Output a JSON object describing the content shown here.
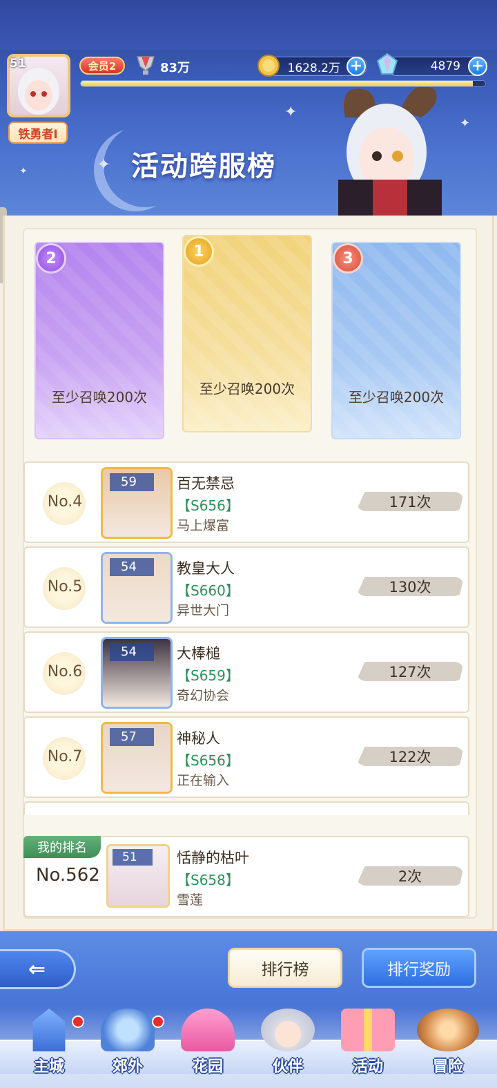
{
  "header": {
    "avatar_level": "51",
    "title_badge": "铁勇者I",
    "vip": "会员2",
    "power": "83万",
    "coins": "1628.2万",
    "gems": "4879",
    "exp_progress": 0.97,
    "page_title": "活动跨服榜"
  },
  "podium": [
    {
      "rank": "2",
      "requirement": "至少召唤200次"
    },
    {
      "rank": "1",
      "requirement": "至少召唤200次"
    },
    {
      "rank": "3",
      "requirement": "至少召唤200次"
    }
  ],
  "list": [
    {
      "rank": "No.4",
      "level": "59",
      "name": "百无禁忌",
      "server": "【S656】",
      "guild": "马上爆富",
      "count": "171次",
      "portrait_color": "#e9c8a8",
      "frame_color": "#f2b944"
    },
    {
      "rank": "No.5",
      "level": "54",
      "name": "教皇大人",
      "server": "【S660】",
      "guild": "异世大门",
      "count": "130次",
      "portrait_color": "#eed9c4",
      "frame_color": "#8fb3ee"
    },
    {
      "rank": "No.6",
      "level": "54",
      "name": "大棒槌",
      "server": "【S659】",
      "guild": "奇幻协会",
      "count": "127次",
      "portrait_color": "#3b3340",
      "frame_color": "#8fb3ee"
    },
    {
      "rank": "No.7",
      "level": "57",
      "name": "神秘人",
      "server": "【S656】",
      "guild": "正在输入",
      "count": "122次",
      "portrait_color": "#e8d6c6",
      "frame_color": "#f2b944"
    }
  ],
  "my_rank": {
    "tag": "我的排名",
    "rank": "No.562",
    "level": "51",
    "name": "恬静的枯叶",
    "server": "【S658】",
    "guild": "雪莲",
    "count": "2次"
  },
  "buttons": {
    "back": "⇐",
    "ranking": "排行榜",
    "rewards": "排行奖励"
  },
  "nav": [
    {
      "label": "主城",
      "icon": "castle-icon",
      "badge": true
    },
    {
      "label": "郊外",
      "icon": "portal-icon",
      "badge": true
    },
    {
      "label": "花园",
      "icon": "heart-icon",
      "badge": false
    },
    {
      "label": "伙伴",
      "icon": "partner-icon",
      "badge": false
    },
    {
      "label": "活动",
      "icon": "gift-icon",
      "badge": false
    },
    {
      "label": "冒险",
      "icon": "compass-icon",
      "badge": false
    }
  ]
}
